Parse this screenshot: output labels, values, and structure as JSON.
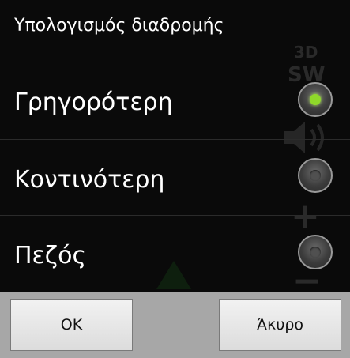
{
  "dialog": {
    "title": "Υπολογισμός διαδρομής",
    "options": [
      {
        "label": "Γρηγορότερη",
        "checked": true
      },
      {
        "label": "Κοντινότερη",
        "checked": false
      },
      {
        "label": "Πεζός",
        "checked": false
      }
    ],
    "buttons": {
      "ok_label": "OK",
      "cancel_label": "Άκυρο"
    }
  },
  "background": {
    "map_3d_label": "3D",
    "compass_label": "SW",
    "zoom_in_symbol": "+",
    "zoom_out_symbol": "−"
  },
  "colors": {
    "selected_radio": "#8fd92a",
    "button_bar": "#a7a7a7"
  }
}
